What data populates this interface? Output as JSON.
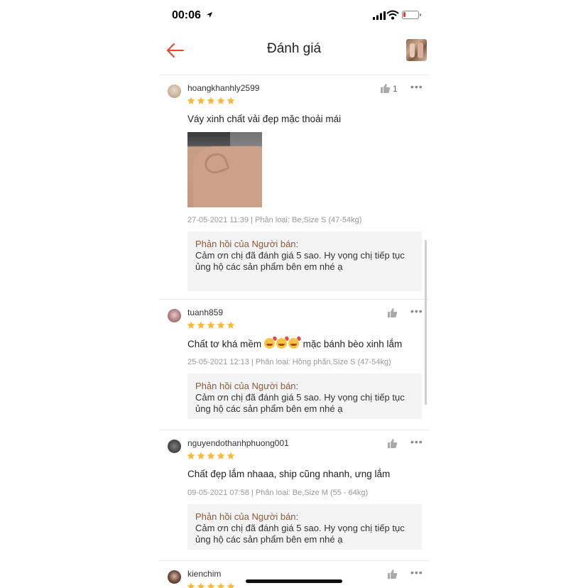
{
  "status_bar": {
    "time": "00:06",
    "battery_level": 0.15,
    "battery_color": "#e53935"
  },
  "header": {
    "title": "Đánh giá",
    "accent": "#e5462a"
  },
  "reviews": [
    {
      "username": "hoangkhanhly2599",
      "rating": 5,
      "like_count": "1",
      "text": "Váy xinh chất vải đẹp mặc thoải mái",
      "has_photo": true,
      "meta": "27-05-2021 11:39 | Phân loại: Be,Size S (47-54kg)",
      "reply_title": "Phản hồi của Người bán:",
      "reply_line1": "Cảm ơn chị đã đánh giá 5 sao. Hy vọng chị tiếp tục",
      "reply_line2": "ủng hộ các sản phẩm bên em nhé ạ"
    },
    {
      "username": "tuanh859",
      "rating": 5,
      "text_before": "Chất tơ khá mềm",
      "text_after": "mặc bánh bèo xinh lắm",
      "meta": "25-05-2021 12:13 | Phân loại: Hồng phấn,Size S (47-54kg)",
      "reply_title": "Phản hồi của Người bán:",
      "reply_line1": "Cảm ơn chị đã đánh giá 5 sao. Hy vọng chị tiếp tục",
      "reply_line2": "ủng hộ các sản phẩm bên em nhé ạ"
    },
    {
      "username": "nguyendothanhphuong001",
      "rating": 5,
      "text": "Chất đẹp lắm nhaaa, ship cũng nhanh, ưng lắm",
      "meta": "09-05-2021 07:58 | Phân loại: Be,Size M (55 - 64kg)",
      "reply_title": "Phản hồi của Người bán:",
      "reply_line1": "Cảm ơn chị đã đánh giá 5 sao. Hy vọng chị tiếp tục",
      "reply_line2": "ủng hộ các sản phẩm bên em nhé ạ"
    },
    {
      "username": "kienchim",
      "rating": 5
    }
  ],
  "icons": {
    "back": "back-arrow-icon",
    "like": "thumbs-up-icon",
    "more": "more-options-icon",
    "star": "star-icon",
    "star_color": "#f6b93b"
  },
  "more_glyph": "•••"
}
